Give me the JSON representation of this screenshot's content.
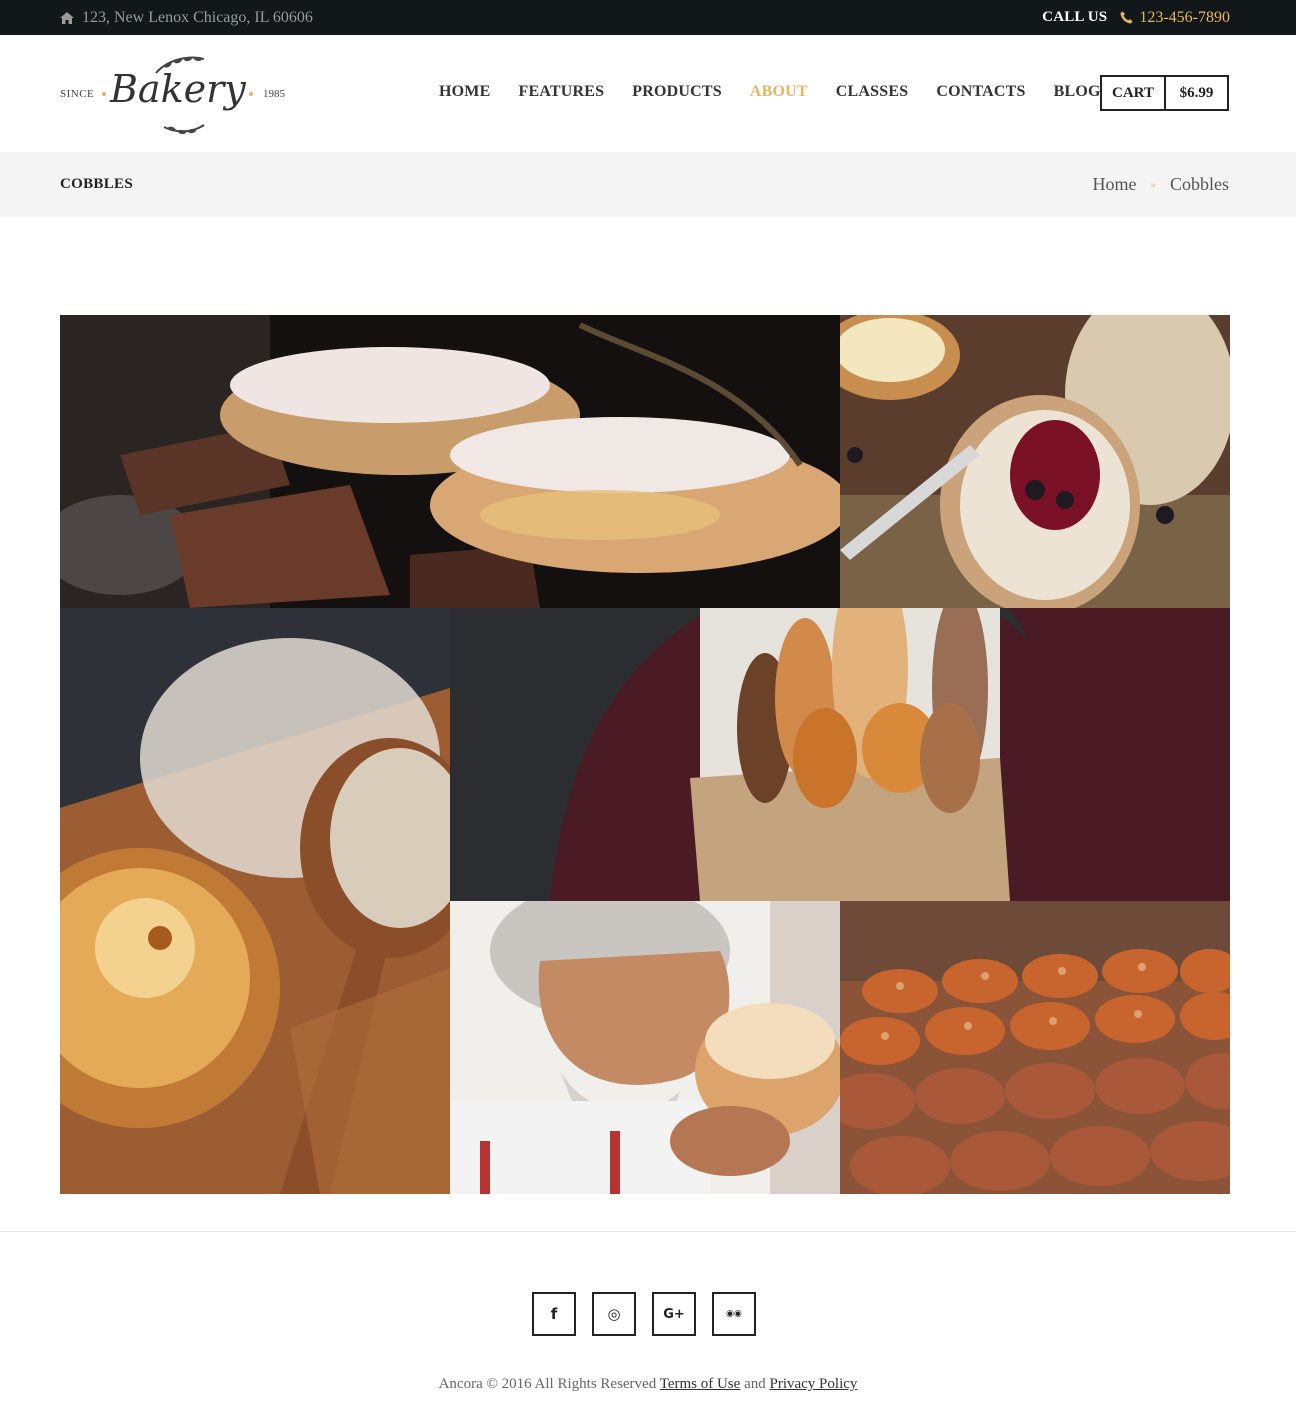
{
  "topbar": {
    "address": "123, New Lenox Chicago, IL 60606",
    "call_label": "CALL US",
    "phone": "123-456-7890"
  },
  "logo": {
    "since": "SINCE",
    "name": "Bakery",
    "year": "1985"
  },
  "nav": [
    "HOME",
    "FEATURES",
    "PRODUCTS",
    "ABOUT",
    "CLASSES",
    "CONTACTS",
    "BLOG"
  ],
  "active_nav": "ABOUT",
  "cart": {
    "label": "CART",
    "amount": "$6.99"
  },
  "page_title": "COBBLES",
  "breadcrumbs": {
    "home": "Home",
    "current": "Cobbles"
  },
  "gallery": [
    {
      "icon": "eclairs-image"
    },
    {
      "icon": "bread-with-jam-image"
    },
    {
      "icon": "flour-board-image"
    },
    {
      "icon": "bread-bag-image"
    },
    {
      "icon": "baker-smelling-bread-image"
    },
    {
      "icon": "baguettes-image"
    }
  ],
  "socials": [
    {
      "icon": "facebook-icon",
      "glyph": "f"
    },
    {
      "icon": "instagram-icon",
      "glyph": "◎"
    },
    {
      "icon": "google-plus-icon",
      "glyph": "G+"
    },
    {
      "icon": "tripadvisor-icon",
      "glyph": "◉◉"
    }
  ],
  "footer": {
    "copyright": "Ancora © 2016 All Rights Reserved",
    "terms": "Terms of Use",
    "and": "and",
    "privacy": "Privacy Policy"
  },
  "colors": {
    "accent": "#e8b55f",
    "topbar_bg": "#121719",
    "title_bg": "#f4f4f4"
  }
}
